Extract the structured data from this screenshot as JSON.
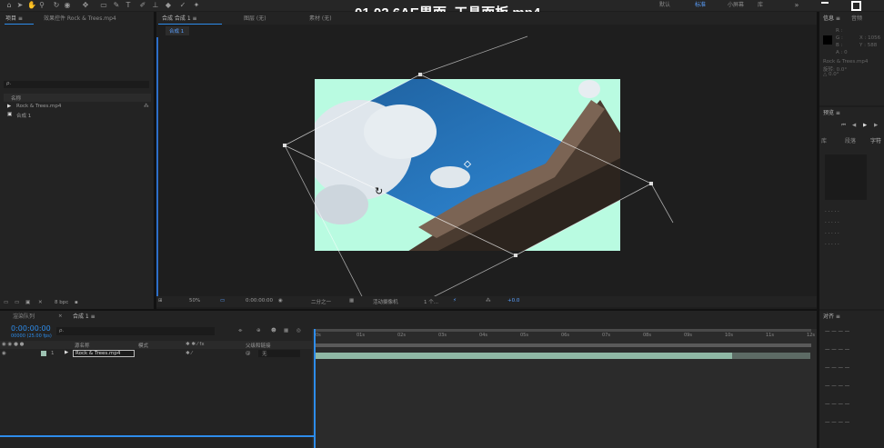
{
  "video_title": "01.02.6AE界面_工具面板.mp4",
  "toolbar": {
    "icons": [
      "home-icon",
      "selection-arrow-icon",
      "hand-icon",
      "zoom-icon",
      "rotate-icon",
      "camera-orbit-icon",
      "pan-behind-icon",
      "rectangle-icon",
      "pen-icon",
      "text-icon",
      "brush-icon",
      "clone-stamp-icon",
      "eraser-icon",
      "roto-brush-icon",
      "puppet-pin-icon"
    ],
    "right_labels": [
      "默认",
      "学习",
      "标准",
      "小屏幕",
      "库"
    ],
    "search_icon": "search-icon"
  },
  "project_panel": {
    "tab_label": "项目 ≡",
    "effect_tab_label": "效果控件 Rock & Trees.mp4",
    "search_placeholder": "ρ.",
    "col_name": "名称",
    "items": [
      {
        "name": "Rock & Trees.mp4",
        "icon": "film-icon"
      },
      {
        "name": "合成 1",
        "icon": "composition-icon"
      }
    ],
    "footer_bpc": "8 bpc"
  },
  "composition_panel": {
    "tab_label": "合成 合成 1 ≡",
    "layer_tab": "图层 (无)",
    "footage_tab": "素材 (无)",
    "subtab": "合成 1",
    "footer": {
      "zoom": "50%",
      "timecode": "0:00:00:00",
      "quality": "二分之一",
      "view": "活动摄像机",
      "views": "1 个...",
      "exposure": "+0.0"
    }
  },
  "info_panel": {
    "tab_label": "信息 ≡",
    "audio_tab": "音频",
    "values": [
      "R :",
      "G :",
      "B :",
      "A : 0"
    ],
    "xy": [
      "X : 1056",
      "Y : 588"
    ],
    "footage_line1": "Rock & Trees.mp4",
    "footage_line2": "旋转: 0.0°",
    "footage_line3": "△ 0.0°"
  },
  "preview_panel": {
    "tab_label": "预览 ≡",
    "subtabs": [
      "库",
      "段落",
      "字符"
    ]
  },
  "align_panel": {
    "tab_label": "对齐 ≡"
  },
  "timeline": {
    "render_queue_tab": "渲染队列",
    "comp_tab": "合成 1 ≡",
    "timecode": "0:00:00:00",
    "fps": "00000 (25.00 fps)",
    "search_placeholder": "ρ.",
    "col_source": "源名称",
    "col_mode": "模式",
    "col_parent": "父级和链接",
    "layer_index": "1",
    "layer_name": "Rock & Trees.mp4",
    "layer_parent": "无",
    "ruler_ticks": [
      "0s",
      "01s",
      "02s",
      "03s",
      "04s",
      "05s",
      "06s",
      "07s",
      "08s",
      "09s",
      "10s",
      "11s",
      "12s"
    ]
  },
  "colors": {
    "accent_blue": "#2d8ceb",
    "canvas_bg": "#b9fbe1",
    "layer_bar": "#8fb8a5",
    "highlight": "#4d9bff"
  }
}
